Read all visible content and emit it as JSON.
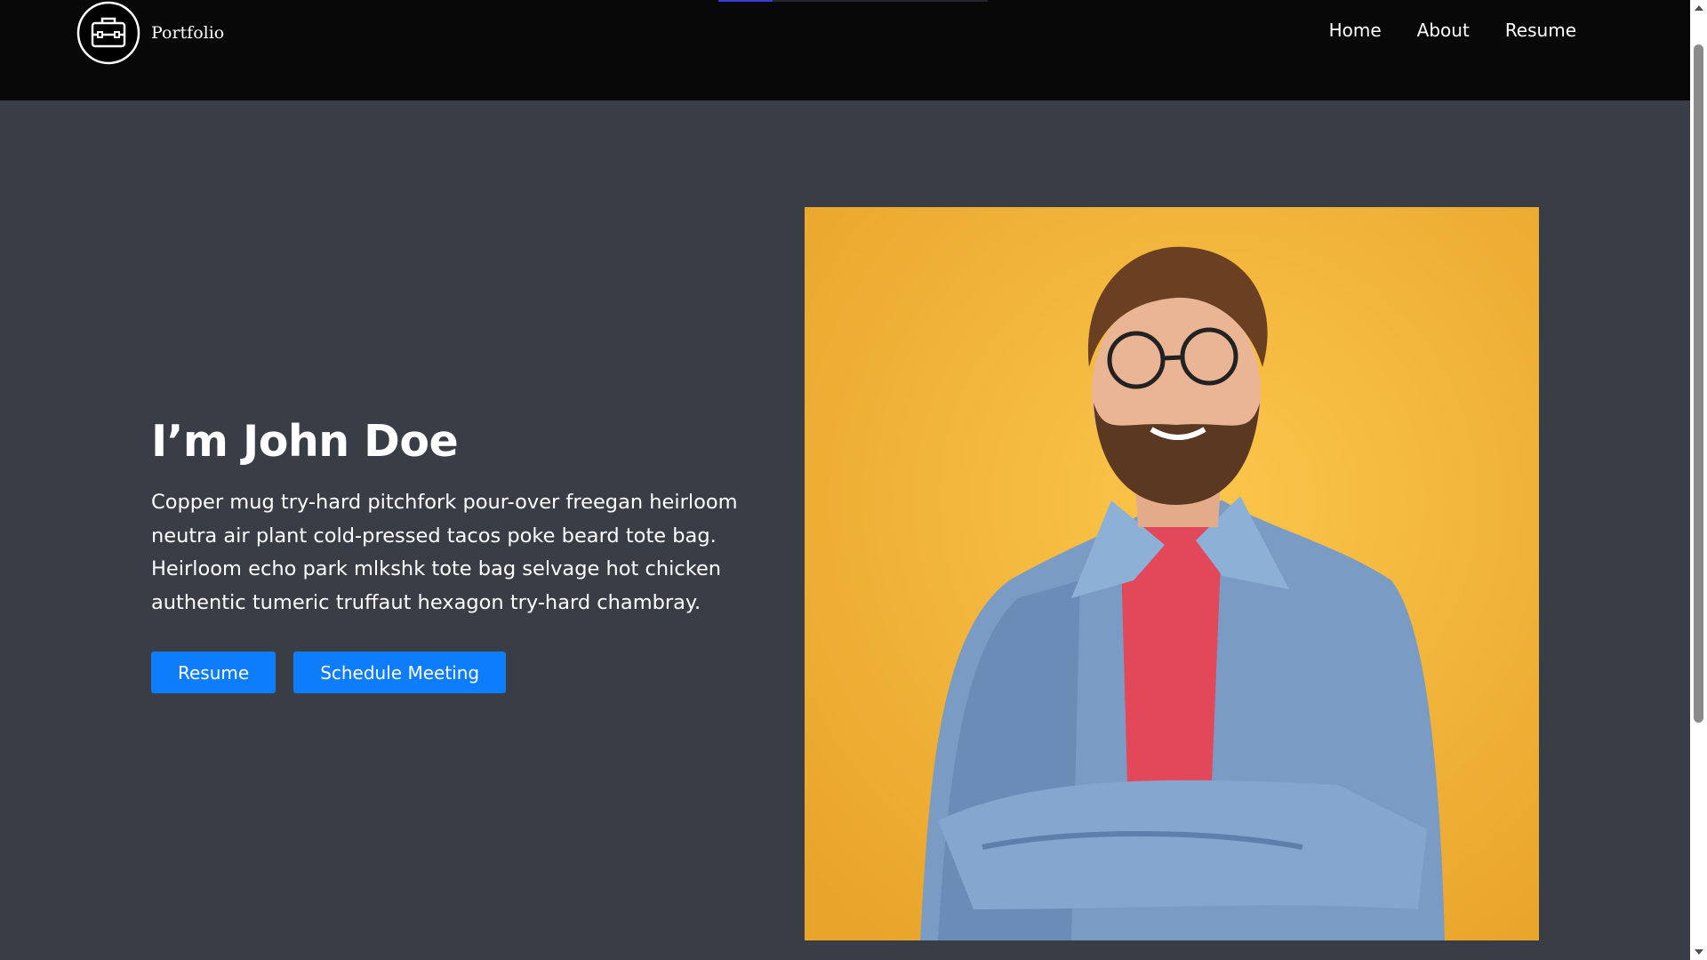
{
  "brand": {
    "name": "Portfolio",
    "logo_icon": "briefcase-icon"
  },
  "nav": {
    "items": [
      {
        "label": "Home"
      },
      {
        "label": "About"
      },
      {
        "label": "Resume"
      }
    ],
    "progress_fraction": 0.2
  },
  "hero": {
    "title": "I’m John Doe",
    "description": "Copper mug try-hard pitchfork pour-over freegan heirloom neutra air plant cold-pressed tacos poke beard tote bag. Heirloom echo park mlkshk tote bag selvage hot chicken authentic tumeric truffaut hexagon try-hard chambray.",
    "buttons": {
      "resume": "Resume",
      "schedule": "Schedule Meeting"
    }
  },
  "colors": {
    "navbar_bg": "#080809",
    "page_bg": "#393d46",
    "button_bg": "#0d7dfc",
    "portrait_bg": "#f6b73e"
  }
}
